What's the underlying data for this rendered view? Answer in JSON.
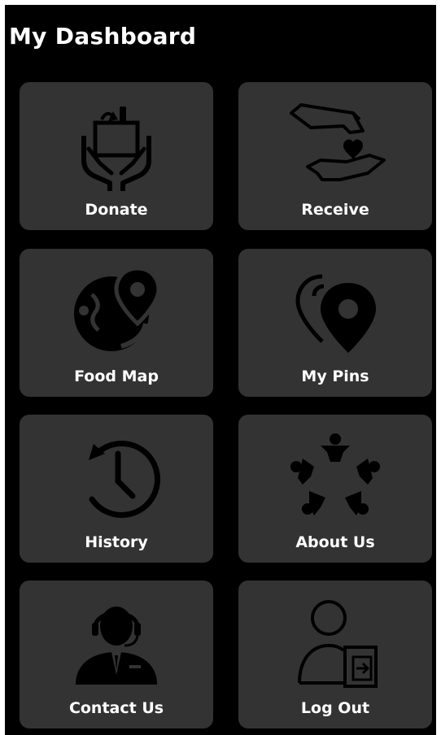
{
  "header": {
    "title": "My Dashboard"
  },
  "tiles": [
    {
      "label": "Donate",
      "icon": "donate-hands-box-icon"
    },
    {
      "label": "Receive",
      "icon": "receive-hands-heart-icon"
    },
    {
      "label": "Food Map",
      "icon": "globe-pin-icon"
    },
    {
      "label": "My Pins",
      "icon": "map-pin-icon"
    },
    {
      "label": "History",
      "icon": "history-clock-icon"
    },
    {
      "label": "About Us",
      "icon": "people-community-icon"
    },
    {
      "label": "Contact Us",
      "icon": "support-agent-icon"
    },
    {
      "label": "Log Out",
      "icon": "logout-user-icon"
    }
  ],
  "colors": {
    "background": "#000000",
    "tile": "#333333",
    "text": "#ffffff",
    "icon": "#000000"
  }
}
